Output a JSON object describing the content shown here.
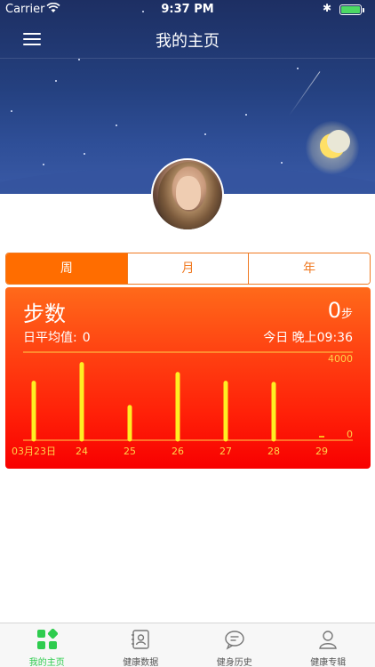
{
  "status_bar": {
    "carrier": "Carrier",
    "time": "9:37 PM"
  },
  "nav": {
    "title": "我的主页"
  },
  "period_tabs": [
    {
      "label": "周",
      "active": true
    },
    {
      "label": "月",
      "active": false
    },
    {
      "label": "年",
      "active": false
    }
  ],
  "steps_card": {
    "title": "步数",
    "value": "0",
    "unit": "步",
    "avg_label": "日平均值:",
    "avg_value": "0",
    "today_label": "今日 晚上09:36"
  },
  "chart_data": {
    "type": "bar",
    "categories": [
      "03月23日",
      "24",
      "25",
      "26",
      "27",
      "28",
      "29"
    ],
    "values": [
      2600,
      3450,
      1500,
      3000,
      2600,
      2550,
      0
    ],
    "ylim": [
      0,
      4000
    ],
    "tick_labels": [
      "4000",
      "0"
    ],
    "bar_color": "#ffee22"
  },
  "colors": {
    "accent": "#ff6d00",
    "card_top": "#ff6a1a",
    "card_bottom": "#f80000",
    "tab_active": "#2ecc4e"
  },
  "tab_bar": [
    {
      "label": "我的主页",
      "icon": "dashboard-icon",
      "active": true
    },
    {
      "label": "健康数据",
      "icon": "contact-book-icon",
      "active": false
    },
    {
      "label": "健身历史",
      "icon": "chat-bubble-icon",
      "active": false
    },
    {
      "label": "健康专辑",
      "icon": "person-icon",
      "active": false
    }
  ]
}
